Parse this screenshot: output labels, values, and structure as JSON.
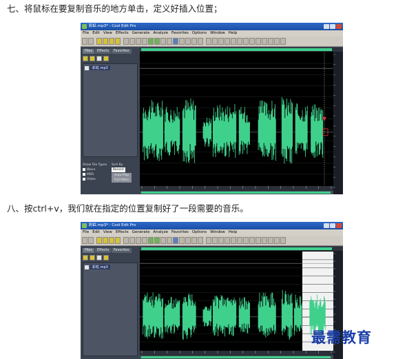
{
  "captions": {
    "step7": "七、将鼠标在要复制音乐的地方单击，定义好插入位置；",
    "step8": "八、按ctrl+v，我们就在指定的位置复制好了一段需要的音乐。"
  },
  "window1": {
    "title": "彩虹.mp3* - Cool Edit Pro",
    "file_name": "彩虹.mp3"
  },
  "window2": {
    "title": "彩虹.mp3* - Cool Edit Pro",
    "file_name": "彩虹.mp3"
  },
  "menu": [
    "File",
    "Edit",
    "View",
    "Effects",
    "Generate",
    "Analyze",
    "Favorites",
    "Options",
    "Window",
    "Help"
  ],
  "tabs": [
    "Files",
    "Effects",
    "Favorites"
  ],
  "file_panel": {
    "show_file_types": "Show File Types",
    "sort_by": "Sort By",
    "file_types": [
      "Wave",
      "MIDI",
      "Video"
    ],
    "sort_value": "Recent",
    "auto_play_button": "Auto Play",
    "full_paths_button": "Full Paths"
  },
  "colors": {
    "waveform": "#3fd08c",
    "cursor_marker": "#e0303a",
    "window_titlebar": "#1b4fa6",
    "pasted_region": "#f2f2f2"
  },
  "icons": [
    "app-icon",
    "minimize-icon",
    "maximize-icon",
    "close-icon",
    "open-file-icon",
    "close-file-icon",
    "folder-icon",
    "audio-file-icon",
    "insert-cursor-marker-icon"
  ],
  "watermark": "最需教育"
}
